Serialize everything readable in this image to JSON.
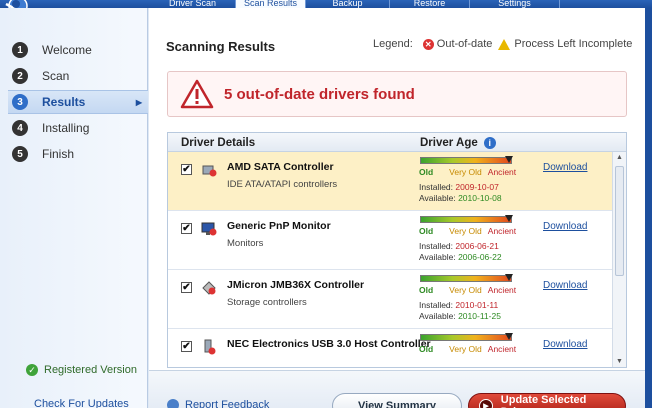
{
  "window": {
    "tabs": [
      {
        "label": "Driver Scan",
        "active": false
      },
      {
        "label": "Scan Results",
        "active": true
      },
      {
        "label": "Backup",
        "active": false
      },
      {
        "label": "Restore",
        "active": false
      },
      {
        "label": "Settings",
        "active": false
      }
    ]
  },
  "sidebar": {
    "steps": [
      {
        "num": "1",
        "label": "Welcome",
        "active": false
      },
      {
        "num": "2",
        "label": "Scan",
        "active": false
      },
      {
        "num": "3",
        "label": "Results",
        "active": true
      },
      {
        "num": "4",
        "label": "Installing",
        "active": false
      },
      {
        "num": "5",
        "label": "Finish",
        "active": false
      }
    ],
    "registered": "Registered Version",
    "check_updates": "Check For Updates"
  },
  "main": {
    "title": "Scanning Results",
    "legend": {
      "label": "Legend:",
      "outdated": "Out-of-date",
      "incomplete": "Process Left Incomplete"
    },
    "alert": "5 out-of-date drivers found",
    "table": {
      "col_details": "Driver Details",
      "col_age": "Driver Age",
      "age_labels": {
        "old": "Old",
        "very_old": "Very Old",
        "ancient": "Ancient"
      },
      "installed_label": "Installed:",
      "available_label": "Available:",
      "download_label": "Download",
      "rows": [
        {
          "name": "AMD SATA Controller",
          "category": "IDE ATA/ATAPI controllers",
          "installed": "2009-10-07",
          "available": "2010-10-08",
          "age_level": 0.97,
          "selected": true,
          "checked": true
        },
        {
          "name": "Generic PnP Monitor",
          "category": "Monitors",
          "installed": "2006-06-21",
          "available": "2006-06-22",
          "age_level": 0.97,
          "selected": false,
          "checked": true
        },
        {
          "name": "JMicron JMB36X Controller",
          "category": "Storage controllers",
          "installed": "2010-01-11",
          "available": "2010-11-25",
          "age_level": 0.97,
          "selected": false,
          "checked": true
        },
        {
          "name": "NEC Electronics USB 3.0 Host Controller",
          "category": "",
          "installed": "",
          "available": "",
          "age_level": 0.97,
          "selected": false,
          "checked": true
        }
      ]
    }
  },
  "bottom": {
    "feedback": "Report Feedback",
    "view_summary": "View Summary",
    "update_selected": "Update Selected Drivers"
  },
  "colors": {
    "accent": "#1d4f9e",
    "alert_red": "#c0252b",
    "selected_row": "#fdf0c6",
    "old_green": "#2e8a23"
  }
}
